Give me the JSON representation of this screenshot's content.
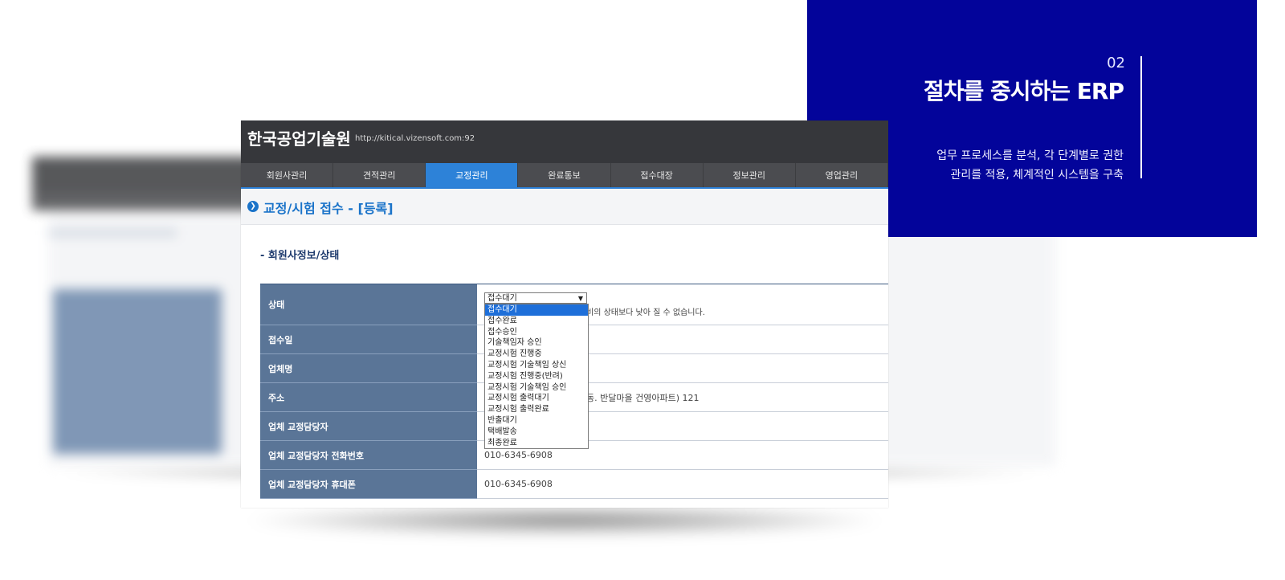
{
  "promo": {
    "number": "02",
    "title": "절차를 중시하는 ERP",
    "desc_line1": "업무 프로세스를 분석, 각 단계별로 권한",
    "desc_line2": "관리를 적용, 체계적인 시스템을 구축"
  },
  "header": {
    "title": "한국공업기술원",
    "url": "http://kitical.vizensoft.com:92"
  },
  "nav": {
    "tabs": [
      "회원사관리",
      "견적관리",
      "교정관리",
      "완료통보",
      "접수대장",
      "정보관리",
      "영업관리"
    ],
    "active_index": 2
  },
  "page": {
    "title": "교정/시험 접수 - [등록]",
    "section_title": "- 회원사정보/상태"
  },
  "form": {
    "rows": [
      {
        "label": "상태",
        "value": ""
      },
      {
        "label": "접수일",
        "value": ""
      },
      {
        "label": "업체명",
        "value": ""
      },
      {
        "label": "주소",
        "value": ""
      },
      {
        "label": "업체 교정담당자",
        "value": ""
      },
      {
        "label": "업체 교정담당자 전화번호",
        "value": "010-6345-6908"
      },
      {
        "label": "업체 교정담당자 휴대폰",
        "value": "010-6345-6908"
      }
    ],
    "status_note": "비의 상태보다 낮아 질 수 없습니다.",
    "address_rest": "동. 반달마을 건영아파트) 121"
  },
  "status_select": {
    "selected": "접수대기",
    "options": [
      "접수대기",
      "접수완료",
      "접수승인",
      "기술책임자 승인",
      "교정시험 진행중",
      "교정시험 기술책임 상신",
      "교정시험 진행중(반려)",
      "교정시험 기술책임 승인",
      "교정시험 출력대기",
      "교정시험 출력완료",
      "반출대기",
      "택배발송",
      "최종완료"
    ]
  },
  "icons": {
    "page_title_icon": "chevron-down-circle-icon",
    "select_arrow": "triangle-down-icon"
  },
  "colors": {
    "promo_bg": "#03049a",
    "nav_active": "#2d82d8",
    "label_bg": "#5a7597",
    "title_blue": "#1a73c9"
  }
}
